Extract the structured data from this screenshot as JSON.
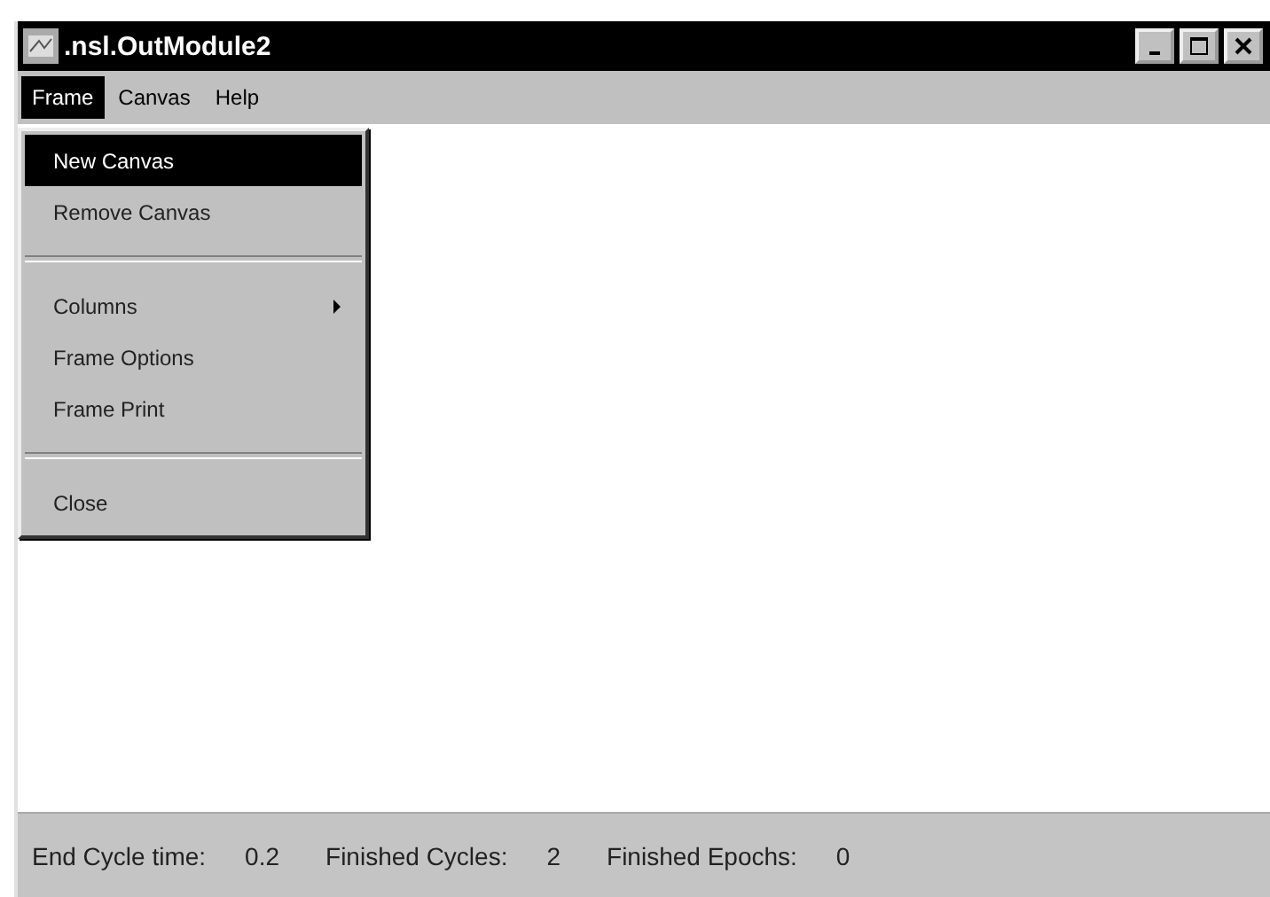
{
  "window": {
    "title": ".nsl.OutModule2"
  },
  "menu_bar": [
    {
      "label": "Frame",
      "selected": true
    },
    {
      "label": "Canvas",
      "selected": false
    },
    {
      "label": "Help",
      "selected": false
    }
  ],
  "menu": {
    "items": [
      {
        "kind": "item",
        "label": "New Canvas",
        "selected": true,
        "submenu": false
      },
      {
        "kind": "item",
        "label": "Remove Canvas",
        "selected": false,
        "submenu": false
      },
      {
        "kind": "separator"
      },
      {
        "kind": "item",
        "label": "Columns",
        "selected": false,
        "submenu": true
      },
      {
        "kind": "item",
        "label": "Frame Options",
        "selected": false,
        "submenu": false
      },
      {
        "kind": "item",
        "label": "Frame Print",
        "selected": false,
        "submenu": false
      },
      {
        "kind": "separator"
      },
      {
        "kind": "item",
        "label": "Close",
        "selected": false,
        "submenu": false
      }
    ]
  },
  "status_bar": [
    {
      "label": "End Cycle time:",
      "value": "0.2"
    },
    {
      "label": "Finished Cycles:",
      "value": "2"
    },
    {
      "label": "Finished Epochs:",
      "value": "0"
    }
  ]
}
